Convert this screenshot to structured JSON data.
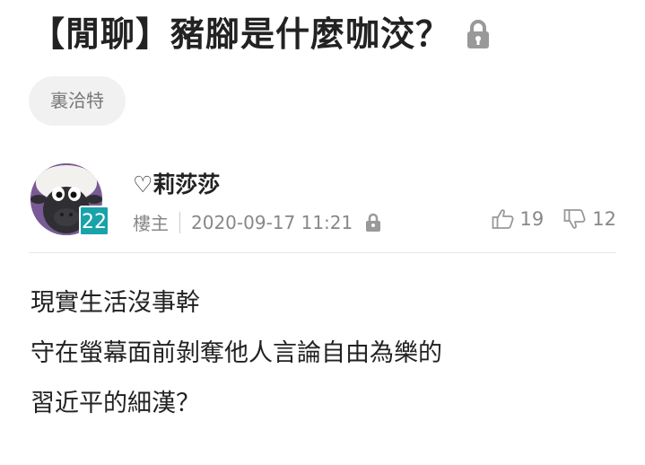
{
  "post": {
    "title": "【閒聊】豬腳是什麼咖洨？",
    "title_locked_icon": "lock-icon",
    "tag": "裏洽特"
  },
  "author": {
    "avatar_icon": "sheep-avatar",
    "level": "22",
    "name": "♡莉莎莎",
    "role": "樓主",
    "timestamp": "2020-09-17 11:21",
    "lock_icon": "lock-icon"
  },
  "votes": {
    "like_icon": "thumbs-up-icon",
    "like_count": "19",
    "dislike_icon": "thumbs-down-icon",
    "dislike_count": "12"
  },
  "content": {
    "lines": [
      "現實生活沒事幹",
      "守在螢幕面前剝奪他人言論自由為樂的",
      "習近平的細漢？"
    ]
  },
  "colors": {
    "level_badge": "#1aa2a9",
    "tag_bg": "#f1f1f1",
    "text_main": "#222222",
    "text_meta": "#888888",
    "icon_gray": "#999999"
  }
}
